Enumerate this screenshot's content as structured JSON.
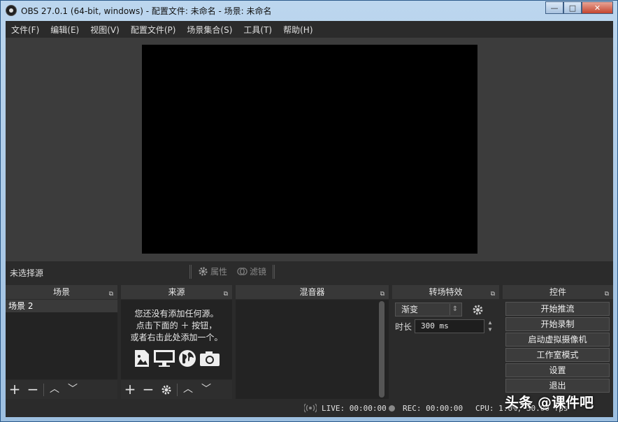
{
  "window": {
    "title": "OBS 27.0.1 (64-bit, windows) - 配置文件: 未命名 - 场景: 未命名",
    "min_label": "—",
    "max_label": "□",
    "close_label": "✕"
  },
  "menu": [
    "文件(F)",
    "编辑(E)",
    "视图(V)",
    "配置文件(P)",
    "场景集合(S)",
    "工具(T)",
    "帮助(H)"
  ],
  "source_toolbar": {
    "no_source_label": "未选择源",
    "properties_label": "属性",
    "filters_label": "滤镜"
  },
  "docks": {
    "scenes": {
      "title": "场景",
      "items": [
        "场景 2"
      ]
    },
    "sources": {
      "title": "来源",
      "empty_line1": "您还没有添加任何源。",
      "empty_line2": "点击下面的 ＋ 按钮，",
      "empty_line3": "或者右击此处添加一个。"
    },
    "mixer": {
      "title": "混音器"
    },
    "transitions": {
      "title": "转场特效",
      "selected": "渐变",
      "duration_label": "时长",
      "duration_value": "300 ms"
    },
    "controls": {
      "title": "控件",
      "buttons": [
        "开始推流",
        "开始录制",
        "启动虚拟摄像机",
        "工作室模式",
        "设置",
        "退出"
      ]
    }
  },
  "status": {
    "live": "LIVE: 00:00:00",
    "rec": "REC: 00:00:00",
    "cpu": "CPU: 1.0%, 30.00 fps"
  },
  "watermark": "头条 @课件吧",
  "colors": {
    "background": "#2b2b2b",
    "preview": "#000000",
    "titlebar": "#bcd6ee"
  }
}
